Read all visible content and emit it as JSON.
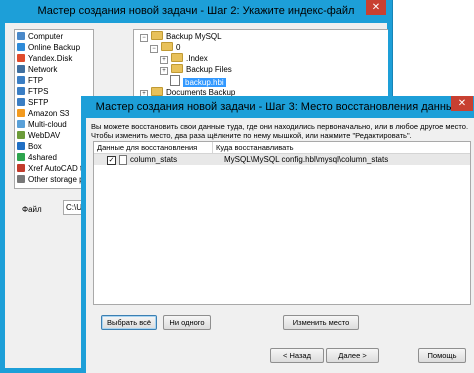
{
  "step2": {
    "title": "Мастер создания новой задачи - Шаг 2: Укажите индекс-файл",
    "close": "✕",
    "left_items": [
      {
        "label": "Computer",
        "color": "#4a89c9"
      },
      {
        "label": "Online Backup",
        "color": "#2e8bd8"
      },
      {
        "label": "Yandex.Disk",
        "color": "#e04b2c"
      },
      {
        "label": "Network",
        "color": "#3f6f9f"
      },
      {
        "label": "FTP",
        "color": "#3a7ec4"
      },
      {
        "label": "FTPS",
        "color": "#3a7ec4"
      },
      {
        "label": "SFTP",
        "color": "#3a7ec4"
      },
      {
        "label": "Amazon S3",
        "color": "#f39a1e"
      },
      {
        "label": "Multi-cloud",
        "color": "#59a0d8"
      },
      {
        "label": "WebDAV",
        "color": "#6c9c3a"
      },
      {
        "label": "Box",
        "color": "#1f6fc4"
      },
      {
        "label": "4shared",
        "color": "#2da44e"
      },
      {
        "label": "Xref AutoCAD t",
        "color": "#c23b2b"
      },
      {
        "label": "Other storage p",
        "color": "#777777"
      }
    ],
    "tree": {
      "backup_mysql": "Backup MySQL",
      "zero": "0",
      "index": ".Index",
      "backup_files": "Backup Files",
      "backup_hbi": "backup.hbi",
      "documents_backup": "Documents Backup"
    },
    "file_label": "Файл",
    "file_value": "C:\\Use"
  },
  "step3": {
    "title": "Мастер создания новой задачи - Шаг 3: Место восстановления данных",
    "close": "✕",
    "info": "Вы можете восстановить свои данные туда, где они находились первоначально, или в любое другое место. Чтобы изменить место, два раза щёлкните по нему мышкой, или нажмите \"Редактировать\".",
    "columns": {
      "col1": "Данные для восстановления",
      "col2": "Куда восстанавливать"
    },
    "rows": [
      {
        "checked": "✓",
        "name": "column_stats",
        "path": "MySQL\\MySQL config.hbl\\mysql\\column_stats"
      }
    ],
    "buttons": {
      "select_all": "Выбрать всё",
      "select_none": "Ни одного",
      "change_location": "Изменить место",
      "back": "< Назад",
      "next": "Далее >",
      "cancel": "Помощь"
    }
  }
}
